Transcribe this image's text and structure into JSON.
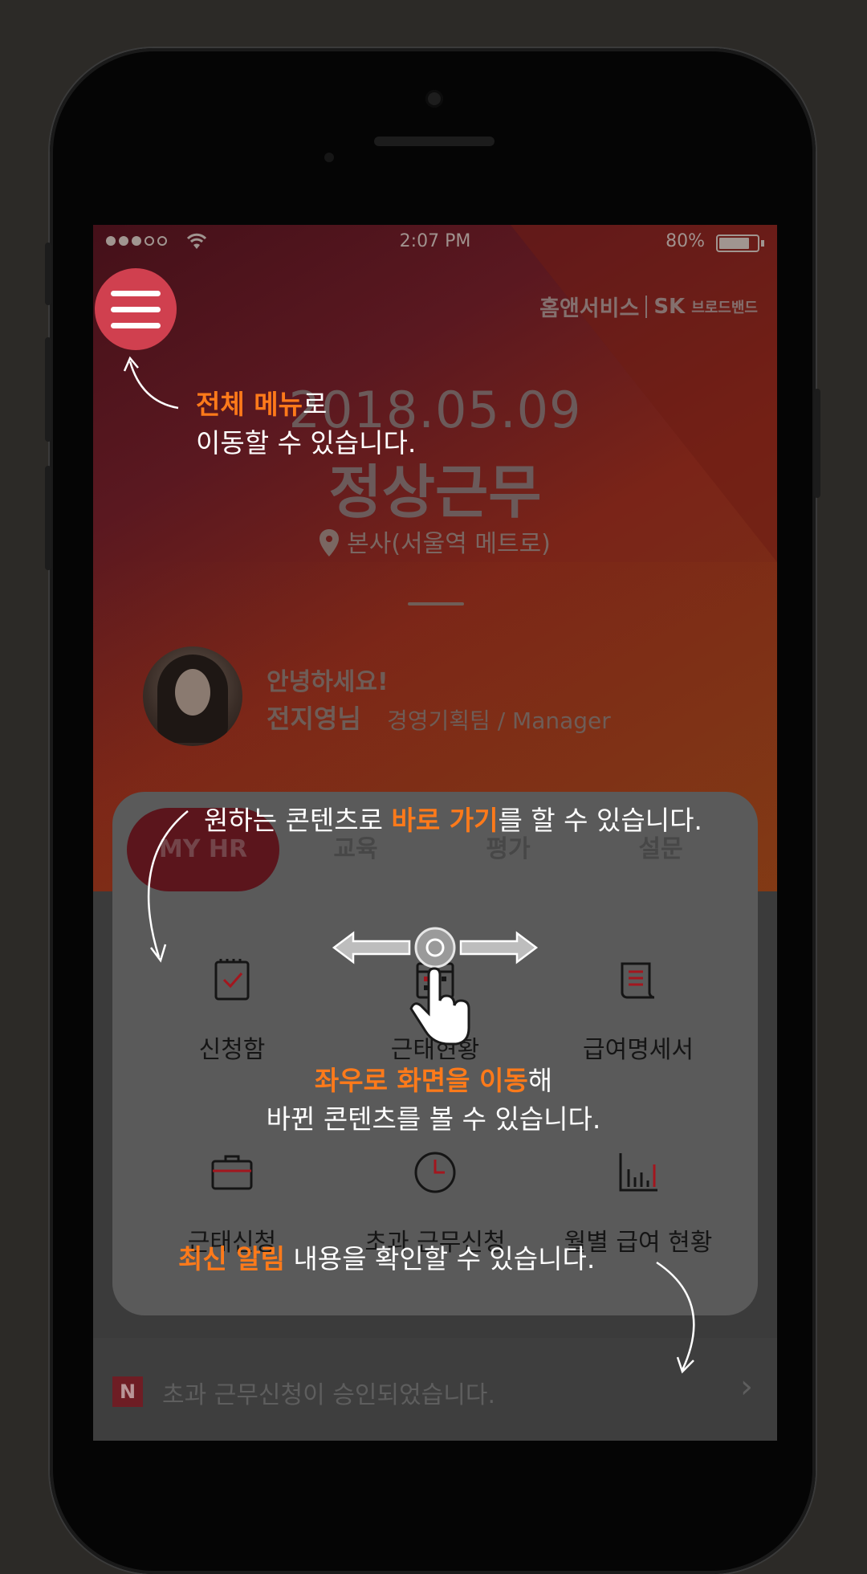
{
  "status_bar": {
    "time": "2:07 PM",
    "battery": "80%",
    "battery_level": 0.8,
    "signal_filled": 3,
    "signal_total": 5
  },
  "brand": {
    "name": "홈앤서비스",
    "sk": "SK",
    "sk_sub": "브로드밴드"
  },
  "attendance": {
    "date": "2018.05.09",
    "status": "정상근무",
    "location": "본사(서울역 메트로)"
  },
  "profile": {
    "greeting": "안녕하세요!",
    "name": "전지영님",
    "department": "경영기획팀  /  Manager"
  },
  "tabs": [
    {
      "label": "MY HR",
      "active": true
    },
    {
      "label": "교육"
    },
    {
      "label": "평가"
    },
    {
      "label": "설문"
    }
  ],
  "menu_items": [
    {
      "label": "신청함",
      "icon": "clipboard-check-icon"
    },
    {
      "label": "근태현황",
      "icon": "calendar-icon"
    },
    {
      "label": "급여명세서",
      "icon": "document-icon"
    },
    {
      "label": "근태신청",
      "icon": "briefcase-icon"
    },
    {
      "label": "초과 근무신청",
      "icon": "clock-icon"
    },
    {
      "label": "월별 급여 현황",
      "icon": "bar-chart-icon"
    }
  ],
  "notification": {
    "badge": "N",
    "text": "초과 근무신청이 승인되었습니다."
  },
  "guide": {
    "menu_hl": "전체 메뉴",
    "menu_rest1": "로",
    "menu_rest2": "이동할 수 있습니다.",
    "shortcut_pre": "원하는 콘텐츠로 ",
    "shortcut_hl": "바로 가기",
    "shortcut_post": "를 할 수 있습니다.",
    "swipe_hl": "좌우로 화면을 이동",
    "swipe_post": "해",
    "swipe_line2": "바뀐 콘텐츠를 볼 수 있습니다.",
    "notice_hl": "최신 알림",
    "notice_post": " 내용을 확인할 수 있습니다."
  },
  "colors": {
    "highlight": "#ff7a1a",
    "menu_button": "#d0404f",
    "accent": "#5b151c"
  }
}
